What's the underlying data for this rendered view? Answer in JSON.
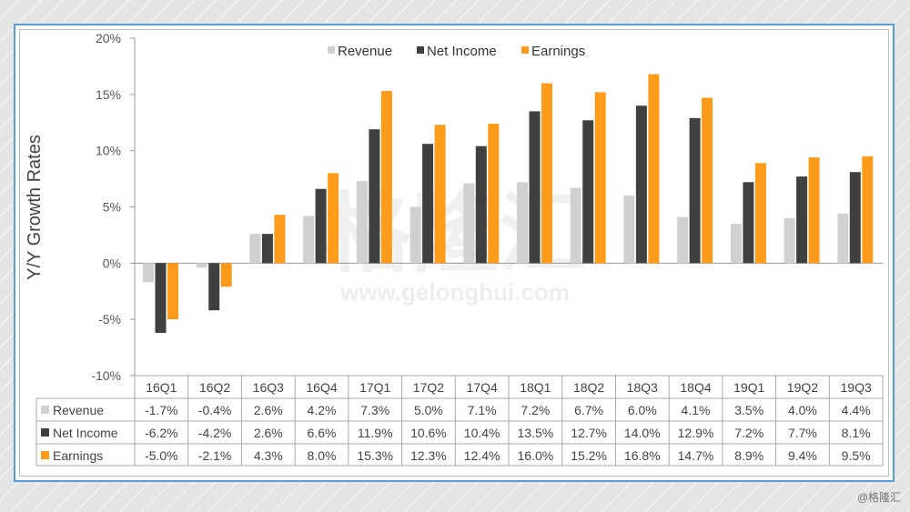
{
  "chart_data": {
    "type": "bar",
    "title": "",
    "xlabel": "",
    "ylabel": "Y/Y Growth Rates",
    "ylim": [
      -10,
      20
    ],
    "yticks": [
      -10,
      -5,
      0,
      5,
      10,
      15,
      20
    ],
    "ytick_labels": [
      "-10%",
      "-5%",
      "0%",
      "5%",
      "10%",
      "15%",
      "20%"
    ],
    "legend_position": "top",
    "grid": false,
    "categories": [
      "16Q1",
      "16Q2",
      "16Q3",
      "16Q4",
      "17Q1",
      "17Q2",
      "17Q4",
      "18Q1",
      "18Q2",
      "18Q3",
      "18Q4",
      "19Q1",
      "19Q2",
      "19Q3"
    ],
    "series": [
      {
        "name": "Revenue",
        "color": "#d0d0d0",
        "values": [
          -1.7,
          -0.4,
          2.6,
          4.2,
          7.3,
          5.0,
          7.1,
          7.2,
          6.7,
          6.0,
          4.1,
          3.5,
          4.0,
          4.4
        ],
        "labels": [
          "-1.7%",
          "-0.4%",
          "2.6%",
          "4.2%",
          "7.3%",
          "5.0%",
          "7.1%",
          "7.2%",
          "6.7%",
          "6.0%",
          "4.1%",
          "3.5%",
          "4.0%",
          "4.4%"
        ]
      },
      {
        "name": "Net Income",
        "color": "#404040",
        "values": [
          -6.2,
          -4.2,
          2.6,
          6.6,
          11.9,
          10.6,
          10.4,
          13.5,
          12.7,
          14.0,
          12.9,
          7.2,
          7.7,
          8.1
        ],
        "labels": [
          "-6.2%",
          "-4.2%",
          "2.6%",
          "6.6%",
          "11.9%",
          "10.6%",
          "10.4%",
          "13.5%",
          "12.7%",
          "14.0%",
          "12.9%",
          "7.2%",
          "7.7%",
          "8.1%"
        ]
      },
      {
        "name": "Earnings",
        "color": "#ff9b1a",
        "values": [
          -5.0,
          -2.1,
          4.3,
          8.0,
          15.3,
          12.3,
          12.4,
          16.0,
          15.2,
          16.8,
          14.7,
          8.9,
          9.4,
          9.5
        ],
        "labels": [
          "-5.0%",
          "-2.1%",
          "4.3%",
          "8.0%",
          "15.3%",
          "12.3%",
          "12.4%",
          "16.0%",
          "15.2%",
          "16.8%",
          "14.7%",
          "8.9%",
          "9.4%",
          "9.5%"
        ]
      }
    ]
  },
  "watermark": {
    "logo": "格隆汇",
    "url": "www.gelonghui.com"
  },
  "credit": "@格隆汇"
}
